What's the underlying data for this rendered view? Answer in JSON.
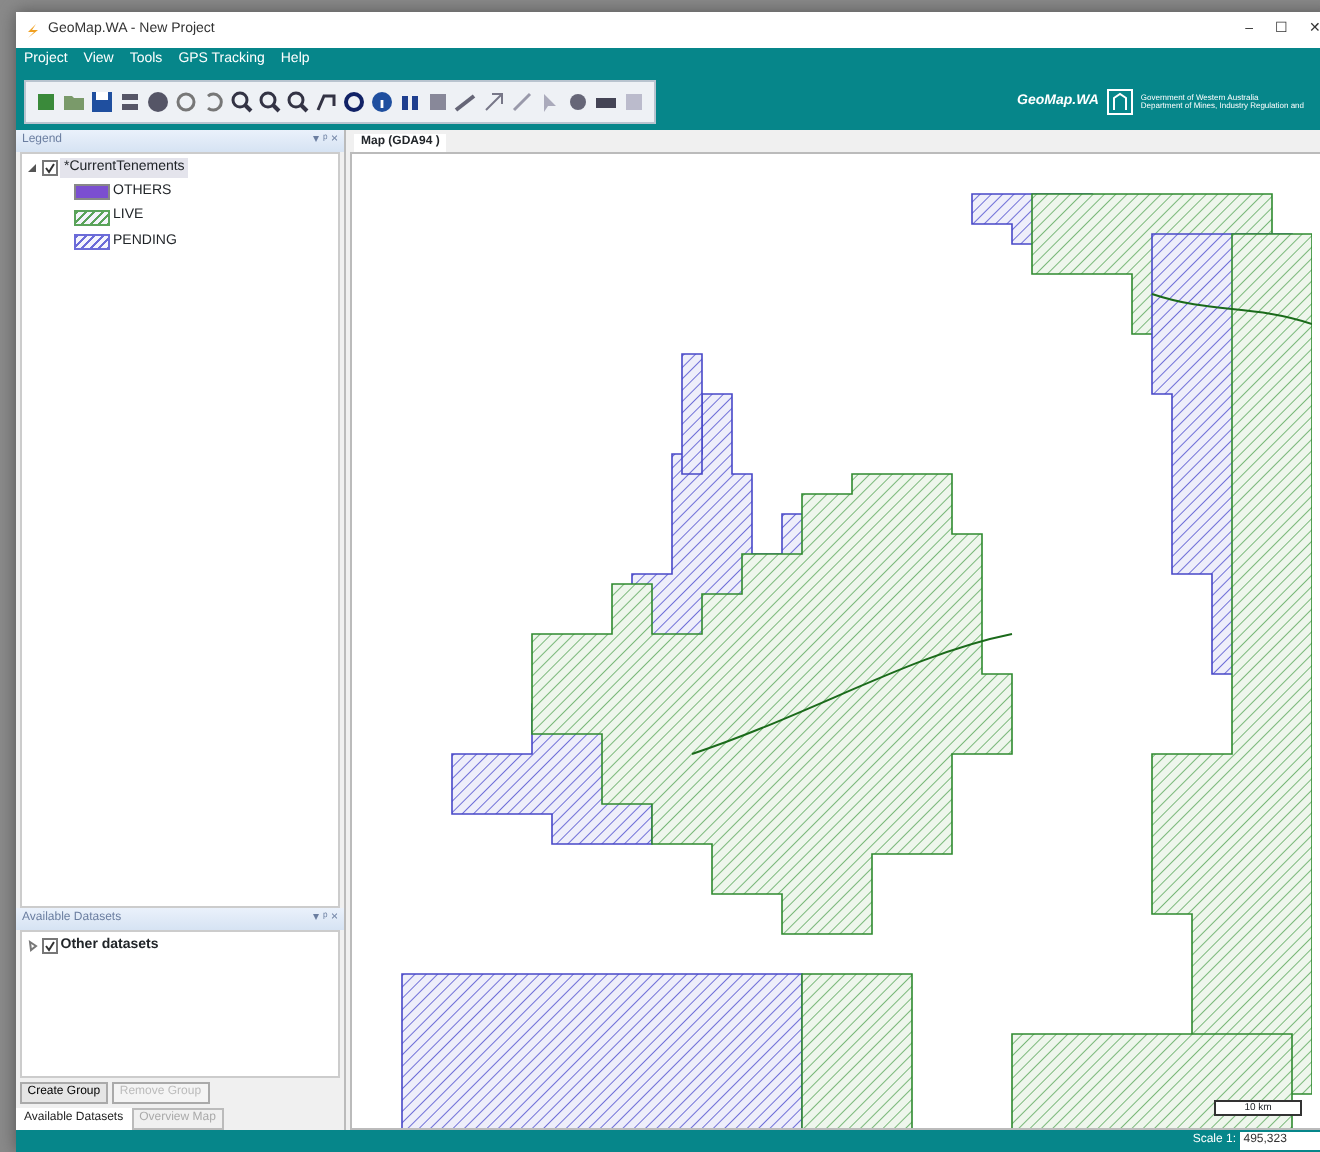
{
  "window": {
    "title": "GeoMap.WA - New Project",
    "controls": [
      "–",
      "☐",
      "✕"
    ]
  },
  "menu": [
    "Project",
    "View",
    "Tools",
    "GPS Tracking",
    "Help"
  ],
  "branding": {
    "app_name": "GeoMap.WA",
    "government": "Government of Western Australia",
    "department": "Department of Mines, Industry Regulation and"
  },
  "legend_panel": {
    "title": "Legend",
    "pin_controls": [
      "▾",
      "ᵖ",
      "×"
    ],
    "layer": {
      "name": "*CurrentTenements",
      "checked": true,
      "expanded": true,
      "children": [
        {
          "label": "OTHERS",
          "kind": "solid",
          "color": "#7b4fd0"
        },
        {
          "label": "LIVE",
          "kind": "hatched",
          "color": "#5aa35a"
        },
        {
          "label": "PENDING",
          "kind": "hatched",
          "color": "#6b6bd8"
        }
      ]
    }
  },
  "datasets_panel": {
    "title": "Available Datasets",
    "pin_controls": [
      "▾",
      "ᵖ",
      "×"
    ],
    "items": [
      {
        "name": "Other datasets",
        "checked": true,
        "expanded": false
      }
    ],
    "buttons": [
      {
        "label": "Create Group",
        "disabled": false
      },
      {
        "label": "Remove Group",
        "disabled": true
      }
    ]
  },
  "bottom_tabs": [
    {
      "label": "Available Datasets",
      "selected": true
    },
    {
      "label": "Overview Map",
      "selected": false
    }
  ],
  "map": {
    "tab": "Map (GDA94 )",
    "scale_bar": "10 km"
  },
  "status_bar": {
    "scale_label": "Scale 1:",
    "scale_value": "495,323"
  }
}
